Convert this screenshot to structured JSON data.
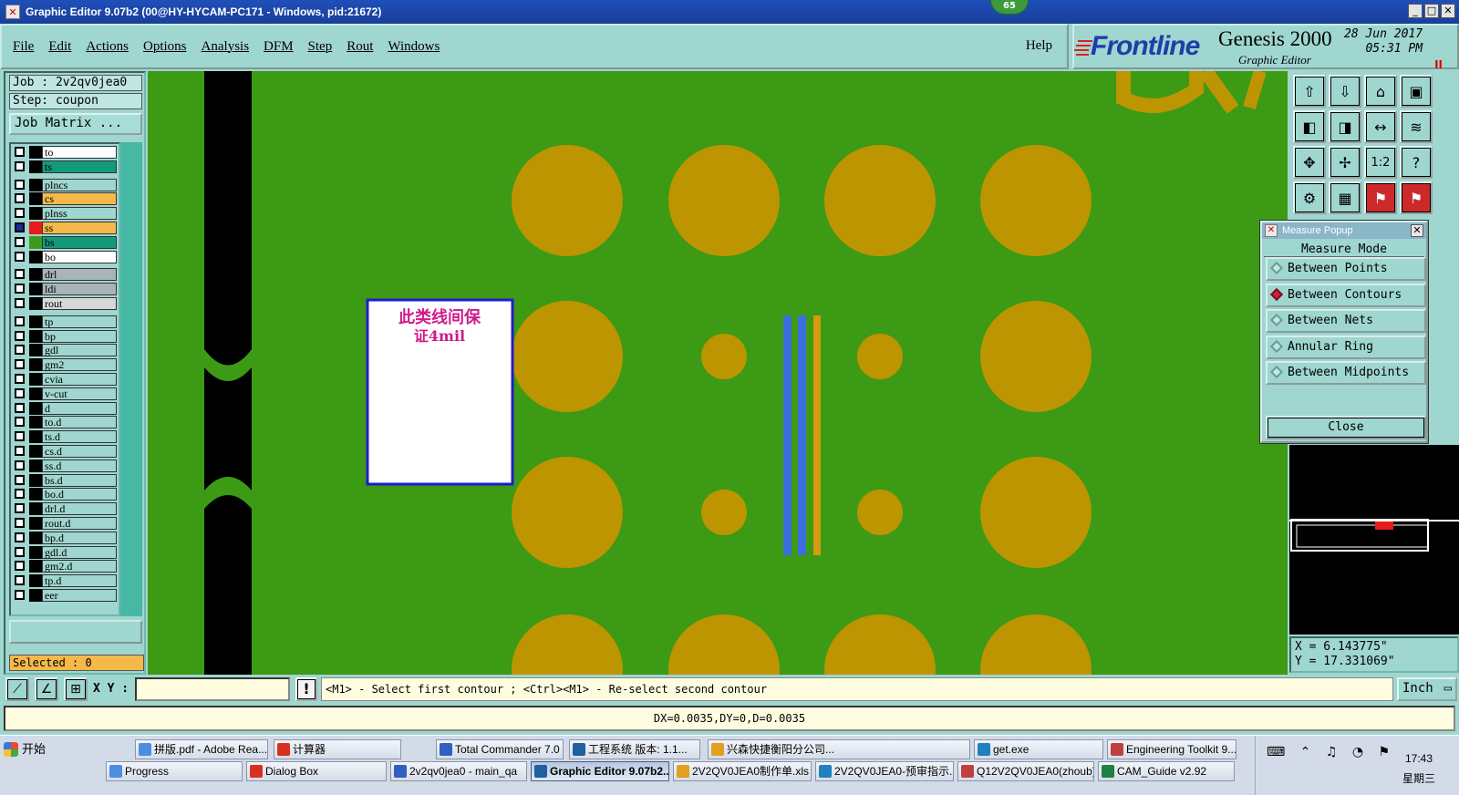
{
  "window": {
    "title": "Graphic Editor 9.07b2 (00@HY-HYCAM-PC171 - Windows, pid:21672)",
    "notification_count": "65"
  },
  "menu": {
    "items": [
      "File",
      "Edit",
      "Actions",
      "Options",
      "Analysis",
      "DFM",
      "Step",
      "Rout",
      "Windows"
    ],
    "help": "Help"
  },
  "brand": {
    "logo": "Frontline",
    "product": "Genesis 2000",
    "subtitle": "Graphic Editor",
    "date": "28 Jun 2017",
    "time": "05:31 PM",
    "pause_glyph": "II"
  },
  "job": {
    "job_line": "Job : 2v2qv0jea0",
    "step_line": "Step: coupon",
    "matrix_button": "Job Matrix ..."
  },
  "layers": [
    {
      "name": "to",
      "color": "#ffffff",
      "sw": "#000000"
    },
    {
      "name": "ts",
      "color": "#139a7a",
      "sw": "#000000"
    },
    {
      "name": "plncs",
      "color": "#9fd6d0",
      "sw": "#000000"
    },
    {
      "name": "cs",
      "color": "#f5b94a",
      "sw": "#000000"
    },
    {
      "name": "plnss",
      "color": "#9fd6d0",
      "sw": "#000000"
    },
    {
      "name": "ss",
      "color": "#f5b94a",
      "sw": "#e61c1c",
      "active": true
    },
    {
      "name": "bs",
      "color": "#139a7a",
      "sw": "#3c9a1c"
    },
    {
      "name": "bo",
      "color": "#ffffff",
      "sw": "#000000"
    },
    {
      "name": "drl",
      "color": "#a8b4b8",
      "sw": "#000000"
    },
    {
      "name": "ldi",
      "color": "#a8b4b8",
      "sw": "#000000"
    },
    {
      "name": "rout",
      "color": "#d8d8d8",
      "sw": "#000000"
    },
    {
      "name": "tp",
      "color": "#9fd6d0",
      "sw": "#000000"
    },
    {
      "name": "bp",
      "color": "#9fd6d0",
      "sw": "#000000"
    },
    {
      "name": "gdl",
      "color": "#9fd6d0",
      "sw": "#000000"
    },
    {
      "name": "gm2",
      "color": "#9fd6d0",
      "sw": "#000000"
    },
    {
      "name": "cvia",
      "color": "#9fd6d0",
      "sw": "#000000"
    },
    {
      "name": "v-cut",
      "color": "#9fd6d0",
      "sw": "#000000"
    },
    {
      "name": "d",
      "color": "#9fd6d0",
      "sw": "#000000"
    },
    {
      "name": "to.d",
      "color": "#9fd6d0",
      "sw": "#000000"
    },
    {
      "name": "ts.d",
      "color": "#9fd6d0",
      "sw": "#000000"
    },
    {
      "name": "cs.d",
      "color": "#9fd6d0",
      "sw": "#000000"
    },
    {
      "name": "ss.d",
      "color": "#9fd6d0",
      "sw": "#000000"
    },
    {
      "name": "bs.d",
      "color": "#9fd6d0",
      "sw": "#000000"
    },
    {
      "name": "bo.d",
      "color": "#9fd6d0",
      "sw": "#000000"
    },
    {
      "name": "drl.d",
      "color": "#9fd6d0",
      "sw": "#000000"
    },
    {
      "name": "rout.d",
      "color": "#9fd6d0",
      "sw": "#000000"
    },
    {
      "name": "bp.d",
      "color": "#9fd6d0",
      "sw": "#000000"
    },
    {
      "name": "gdl.d",
      "color": "#9fd6d0",
      "sw": "#000000"
    },
    {
      "name": "gm2.d",
      "color": "#9fd6d0",
      "sw": "#000000"
    },
    {
      "name": "tp.d",
      "color": "#9fd6d0",
      "sw": "#000000"
    },
    {
      "name": "eer",
      "color": "#9fd6d0",
      "sw": "#000000"
    }
  ],
  "selected": "Selected : 0",
  "canvas": {
    "note_text_line1": "此类线间保",
    "note_text_line2": "证4mil",
    "colors": {
      "board": "#3d9a15",
      "pad": "#bd9500",
      "line_blue": "#3d6ee0",
      "line_orange": "#d79a10",
      "slot": "#000000"
    }
  },
  "toolbar_icons": [
    "zoom-home-icon",
    "zoom-in-icon",
    "zoom-fit-icon",
    "zoom-window-icon",
    "pan-left-icon",
    "pan-right-icon",
    "center-icon",
    "redraw-icon",
    "zoom-area-icon",
    "move-icon",
    "scale-icon",
    "help-icon",
    "snap-icon",
    "grid-icon",
    "measure-icon",
    "measure-icon-2"
  ],
  "toolbar_glyphs": [
    "⇧",
    "⇩",
    "⌂",
    "▣",
    "◧",
    "◨",
    "↔",
    "≋",
    "✥",
    "✢",
    "1:2",
    "?",
    "⚙",
    "▦",
    "⚑",
    "⚑"
  ],
  "measure": {
    "title": "Measure Popup",
    "mode_label": "Measure Mode",
    "options": [
      "Between Points",
      "Between Contours",
      "Between Nets",
      "Annular Ring",
      "Between Midpoints"
    ],
    "selected_option": "Between Contours",
    "close": "Close"
  },
  "coords": {
    "x": "X = 6.143775\"",
    "y": "Y = 17.331069\""
  },
  "command": {
    "xy_label": "X Y :",
    "xy_value": "",
    "excl": "!",
    "prompt": "<M1> - Select first contour ; <Ctrl><M1> - Re-select second contour",
    "units": "Inch"
  },
  "status": "DX=0.0035,DY=0,D=0.0035",
  "taskbar": {
    "start": "开始",
    "row1": [
      "拼版.pdf - Adobe Rea...",
      "计算器",
      "Total Commander 7.0 ...",
      "工程系统  版本: 1.1...",
      "兴森快捷衡阳分公司...",
      "get.exe",
      "Engineering Toolkit 9...."
    ],
    "row2": [
      "Progress",
      "Dialog Box",
      "2v2qv0jea0 - main_qa",
      "Graphic Editor 9.07b2...",
      "2V2QV0JEA0制作单.xls ...",
      "2V2QV0JEA0-预审指示...",
      "Q12V2QV0JEA0(zhoub)....",
      "CAM_Guide v2.92"
    ],
    "active": "Graphic Editor 9.07b2...",
    "time": "17:43",
    "day": "星期三"
  }
}
